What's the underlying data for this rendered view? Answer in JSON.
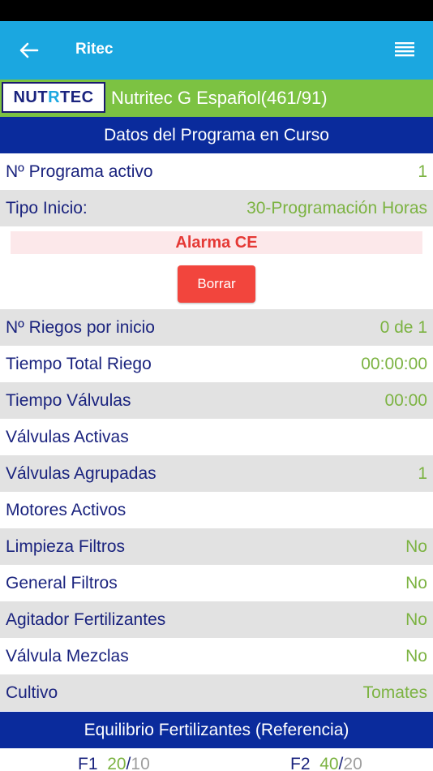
{
  "header": {
    "title": "Ritec",
    "back_icon": "arrow-left-icon",
    "menu_icon": "hamburger-menu-icon"
  },
  "device": {
    "logo_text_a": "NUT",
    "logo_text_b": "R",
    "logo_text_c": "TEC",
    "name": "Nutritec G Español(461/91)"
  },
  "program_section": {
    "title": "Datos del Programa en Curso"
  },
  "rows_top": [
    {
      "label": "Nº Programa activo",
      "value": "1"
    },
    {
      "label": "Tipo Inicio:",
      "value": "30-Programación Horas"
    }
  ],
  "alarm": {
    "text": "Alarma CE",
    "button_label": "Borrar"
  },
  "rows": [
    {
      "label": "Nº Riegos por inicio",
      "value": "0 de 1"
    },
    {
      "label": "Tiempo Total Riego",
      "value": "00:00:00"
    },
    {
      "label": "Tiempo Válvulas",
      "value": "00:00"
    },
    {
      "label": "Válvulas Activas",
      "value": ""
    },
    {
      "label": "Válvulas Agrupadas",
      "value": "1"
    },
    {
      "label": "Motores Activos",
      "value": ""
    },
    {
      "label": "Limpieza Filtros",
      "value": "No"
    },
    {
      "label": "General Filtros",
      "value": "No"
    },
    {
      "label": "Agitador Fertilizantes",
      "value": "No"
    },
    {
      "label": "Válvula Mezclas",
      "value": "No"
    },
    {
      "label": "Cultivo",
      "value": "Tomates"
    }
  ],
  "fert_section": {
    "title": "Equilibrio Fertilizantes (Referencia)"
  },
  "fertilizers": [
    {
      "name": "F1",
      "current": "20",
      "reference": "10"
    },
    {
      "name": "F2",
      "current": "40",
      "reference": "20"
    }
  ],
  "colors": {
    "app_bar": "#1BA7E0",
    "device_bar": "#7CC242",
    "section_header": "#0A2B9C",
    "label_text": "#1a237e",
    "value_text": "#7CB342",
    "alarm_text": "#E53935",
    "alarm_bg": "#FCE8EA",
    "button_bg": "#F2453D"
  }
}
